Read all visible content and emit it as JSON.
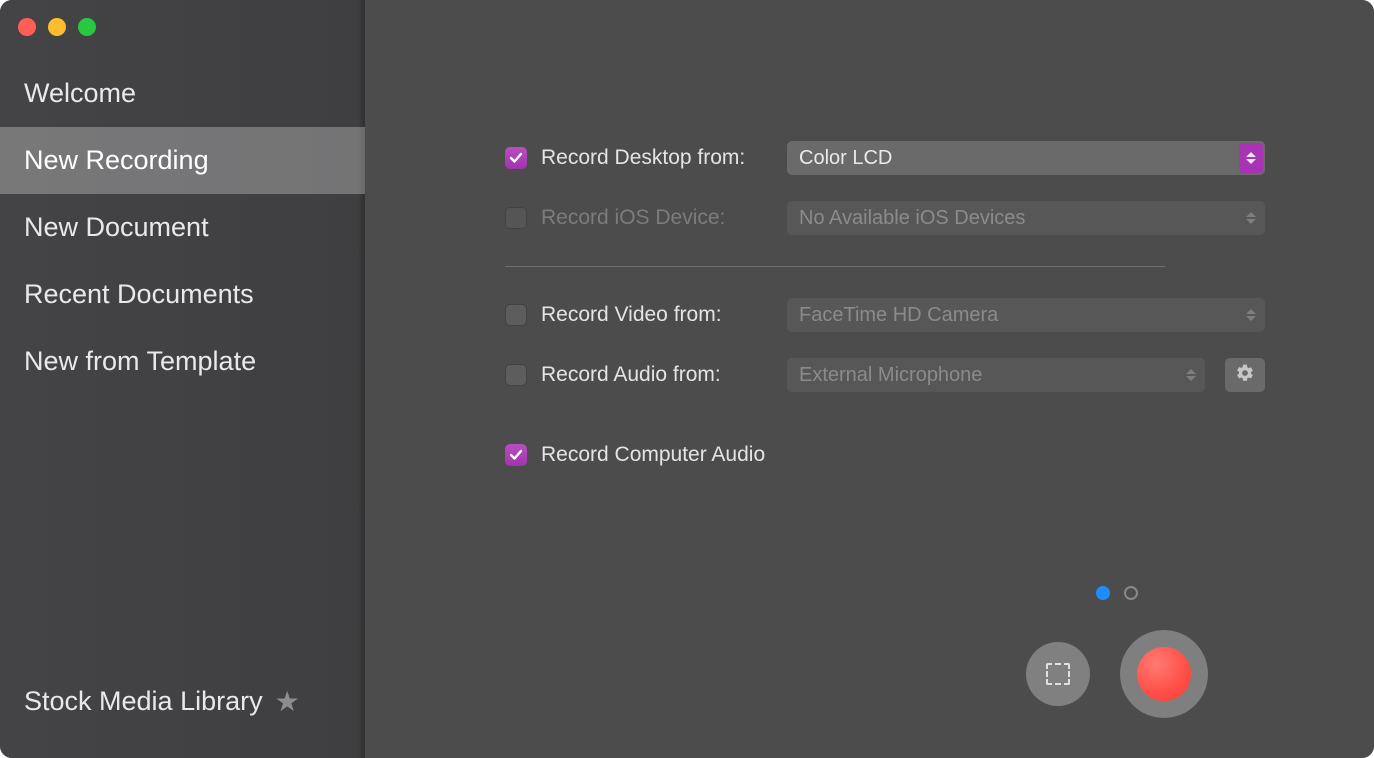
{
  "sidebar": {
    "items": [
      {
        "label": "Welcome"
      },
      {
        "label": "New Recording"
      },
      {
        "label": "New Document"
      },
      {
        "label": "Recent Documents"
      },
      {
        "label": "New from Template"
      }
    ],
    "active_index": 1,
    "stock_label": "Stock Media Library"
  },
  "recording": {
    "desktop": {
      "label": "Record Desktop from:",
      "checked": true,
      "select_value": "Color LCD",
      "enabled": true
    },
    "ios": {
      "label": "Record iOS Device:",
      "checked": false,
      "select_value": "No Available iOS Devices",
      "enabled": false
    },
    "video": {
      "label": "Record Video from:",
      "checked": false,
      "select_value": "FaceTime HD Camera",
      "enabled": true
    },
    "audio": {
      "label": "Record Audio from:",
      "checked": false,
      "select_value": "External Microphone",
      "enabled": true
    },
    "computer_audio": {
      "label": "Record Computer Audio",
      "checked": true
    }
  },
  "pager": {
    "count": 2,
    "active": 0
  },
  "colors": {
    "accent": "#a833b4",
    "record": "#ff4e47",
    "pager_active": "#1f8cff"
  }
}
